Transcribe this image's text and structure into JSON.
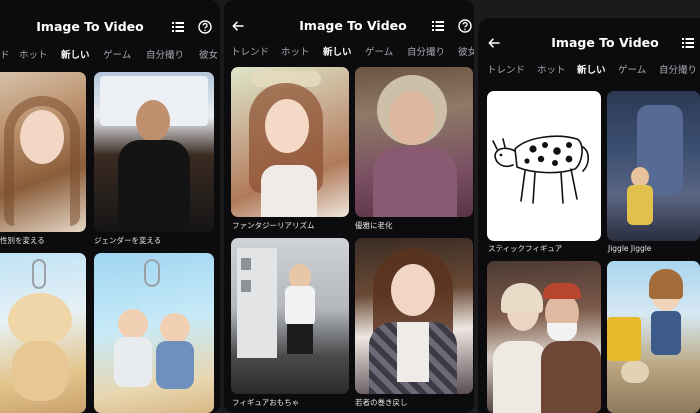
{
  "screens": [
    {
      "title": "Image To Video",
      "tabs": [
        {
          "label": "ド",
          "active": false
        },
        {
          "label": "ホット",
          "active": false
        },
        {
          "label": "新しい",
          "active": true
        },
        {
          "label": "ゲーム",
          "active": false
        },
        {
          "label": "自分撮り",
          "active": false
        },
        {
          "label": "彼女",
          "active": false
        }
      ],
      "cards": [
        {
          "caption": "性別を変える",
          "image": "young woman portrait"
        },
        {
          "caption": "ジェンダーを変える",
          "image": "muscular man in black t-shirt"
        },
        {
          "caption": "",
          "image": "plush puppy keychain on beach"
        },
        {
          "caption": "",
          "image": "figurine couple keychain on beach"
        }
      ]
    },
    {
      "title": "Image To Video",
      "tabs": [
        {
          "label": "トレンド",
          "active": false
        },
        {
          "label": "ホット",
          "active": false
        },
        {
          "label": "新しい",
          "active": true
        },
        {
          "label": "ゲーム",
          "active": false
        },
        {
          "label": "自分撮り",
          "active": false
        },
        {
          "label": "彼女",
          "active": false
        }
      ],
      "cards": [
        {
          "caption": "ファンタジーリアリズム",
          "image": "woman with flower crown"
        },
        {
          "caption": "優雅に老化",
          "image": "elderly woman portrait"
        },
        {
          "caption": "フィギュアおもちゃ",
          "image": "woman in front of building"
        },
        {
          "caption": "若者の巻き戻し",
          "image": "young woman in plaid shirt"
        }
      ]
    },
    {
      "title": "Image To Video",
      "tabs": [
        {
          "label": "トレンド",
          "active": false
        },
        {
          "label": "ホット",
          "active": false
        },
        {
          "label": "新しい",
          "active": true
        },
        {
          "label": "ゲーム",
          "active": false
        },
        {
          "label": "自分撮り",
          "active": false
        }
      ],
      "cards": [
        {
          "caption": "スティックフィギュア",
          "image": "stick figure cow drawing"
        },
        {
          "caption": "Jiggle Jiggle",
          "image": "3d cartoon girl with robot"
        },
        {
          "caption": "",
          "image": "elderly couple with mugs"
        },
        {
          "caption": "",
          "image": "cartoon girl with dog and school bus"
        }
      ]
    }
  ],
  "icons": {
    "back": "back-arrow-icon",
    "list": "list-icon",
    "help": "help-icon"
  },
  "colors": {
    "background": "#0c0c0e",
    "text": "#ffffff",
    "tab_inactive": "#a7a7ad"
  }
}
